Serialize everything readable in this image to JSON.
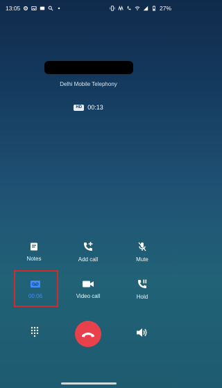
{
  "status_bar": {
    "time": "13:05",
    "battery": "27%",
    "icons_left": [
      "gear-icon",
      "gallery-icon",
      "message-icon",
      "search-icon",
      "dot-icon"
    ],
    "icons_right": [
      "vibrate-icon",
      "carrier-logo-icon",
      "wifi-call-icon",
      "wifi-icon",
      "signal-icon",
      "battery-icon"
    ]
  },
  "call": {
    "carrier": "Delhi Mobile Telephony",
    "hd_label": "HD",
    "duration": "00:13"
  },
  "actions": {
    "notes": "Notes",
    "add_call": "Add call",
    "mute": "Mute",
    "record_time": "00:06",
    "video_call": "Video call",
    "hold": "Hold"
  },
  "colors": {
    "end_call": "#e8414b",
    "record_active": "#3f8cff",
    "highlight": "#d12a2a"
  }
}
